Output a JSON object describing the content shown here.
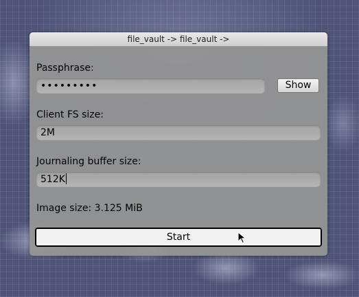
{
  "window": {
    "title": "file_vault -> file_vault ->"
  },
  "passphrase": {
    "label": "Passphrase:",
    "value": "•••••••••",
    "show_label": "Show"
  },
  "client_fs": {
    "label": "Client FS size:",
    "value": "2M"
  },
  "journal": {
    "label": "Journaling buffer size:",
    "value": "512K"
  },
  "image_size": {
    "text": "Image size: 3.125 MiB"
  },
  "start": {
    "label": "Start"
  },
  "colors": {
    "window_bg": "#969696",
    "field_bg": "#ababab",
    "desktop_bg": "#4f5478"
  },
  "icons": {
    "pointer": "mouse-pointer-icon"
  }
}
